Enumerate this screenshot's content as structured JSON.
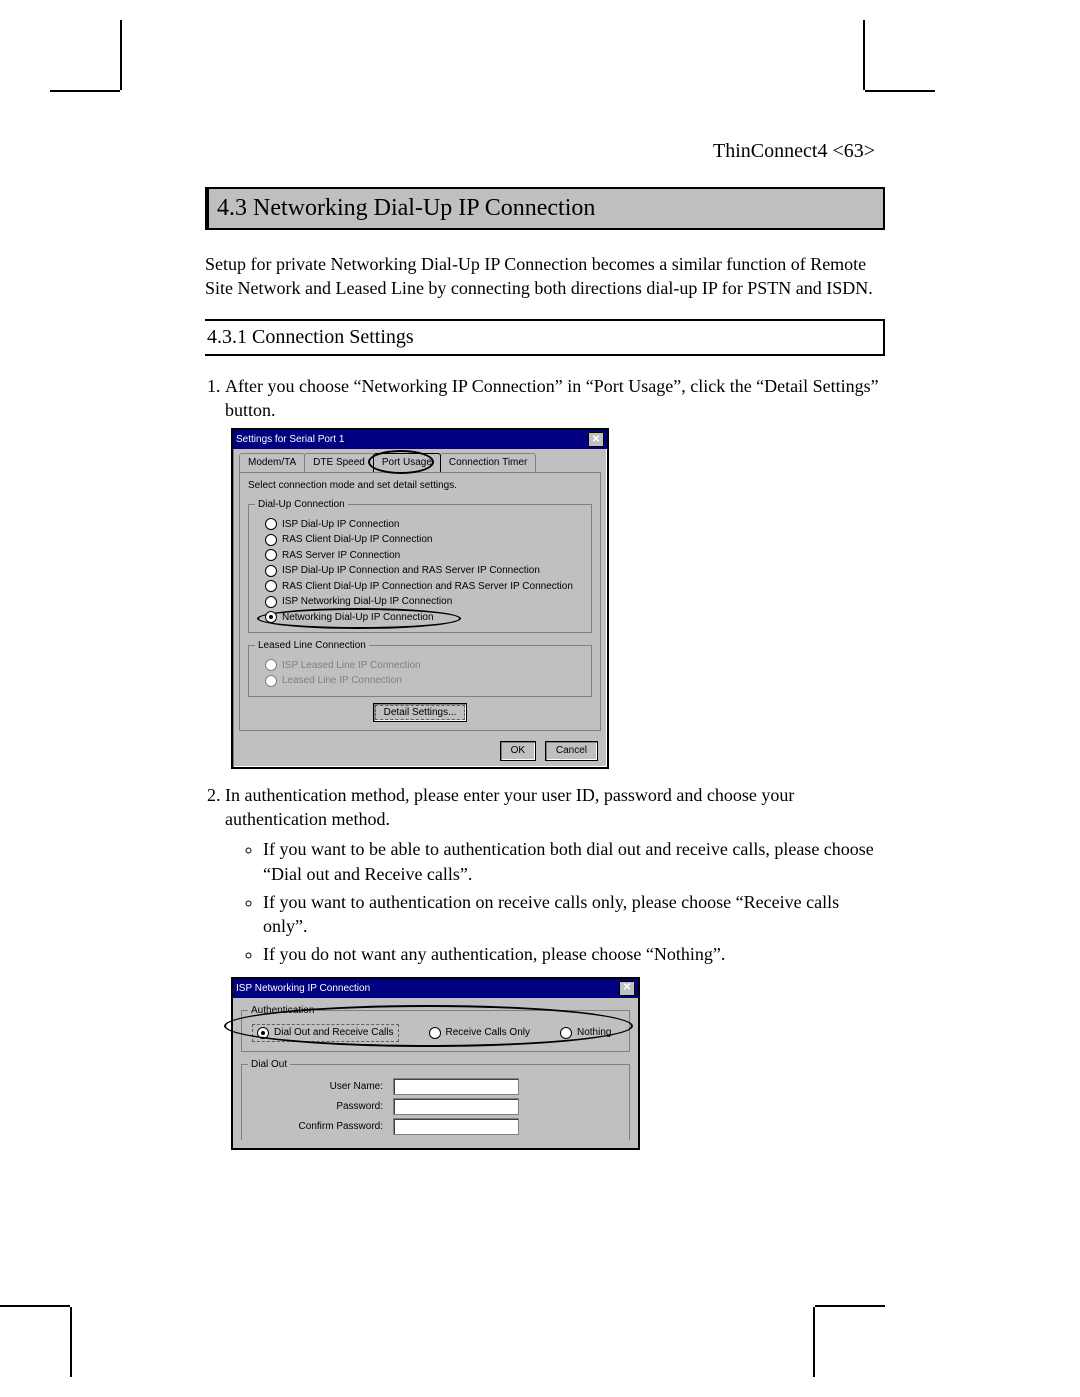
{
  "header": {
    "text": "ThinConnect4 <63>"
  },
  "section": {
    "title": "4.3 Networking Dial-Up IP Connection"
  },
  "intro": "Setup for private Networking Dial-Up IP Connection becomes a similar function of Remote Site Network and Leased Line by connecting both directions dial-up IP for PSTN and ISDN.",
  "subsection": {
    "title": "4.3.1 Connection Settings"
  },
  "steps": {
    "s1": "After you choose “Networking IP Connection” in “Port Usage”, click the “Detail Settings” button.",
    "s2": "In authentication method, please enter your user ID, password and choose your authentication method.",
    "b1": "If you want to be able to authentication both dial out and receive calls, please choose “Dial out and Receive calls”.",
    "b2": "If you want to authentication on receive calls only, please choose “Receive calls only”.",
    "b3": "If you do not want any authentication, please choose “Nothing”."
  },
  "dialog1": {
    "title": "Settings for Serial Port 1",
    "close": "✕",
    "tabs": {
      "t1": "Modem/TA",
      "t2": "DTE Speed",
      "t3": "Port Usage",
      "t4": "Connection Timer"
    },
    "instr": "Select connection mode and set detail settings.",
    "group1": "Dial-Up Connection",
    "opts": {
      "o1": "ISP Dial-Up IP Connection",
      "o2": "RAS Client Dial-Up IP Connection",
      "o3": "RAS Server IP Connection",
      "o4": "ISP Dial-Up IP Connection and RAS Server IP Connection",
      "o5": "RAS Client Dial-Up IP Connection and RAS Server IP Connection",
      "o6": "ISP Networking Dial-Up IP Connection",
      "o7": "Networking Dial-Up IP Connection"
    },
    "group2": "Leased Line Connection",
    "lopts": {
      "l1": "ISP Leased Line IP Connection",
      "l2": "Leased Line IP Connection"
    },
    "detailBtn": "Detail Settings...",
    "okBtn": "OK",
    "cancelBtn": "Cancel"
  },
  "dialog2": {
    "title": "ISP Networking IP Connection",
    "close": "✕",
    "authLegend": "Authentication",
    "a1": "Dial Out and Receive Calls",
    "a2": "Receive Calls Only",
    "a3": "Nothing",
    "dialOutLegend": "Dial Out",
    "userLabel": "User Name:",
    "passLabel": "Password:",
    "confirmLabel": "Confirm Password:"
  }
}
